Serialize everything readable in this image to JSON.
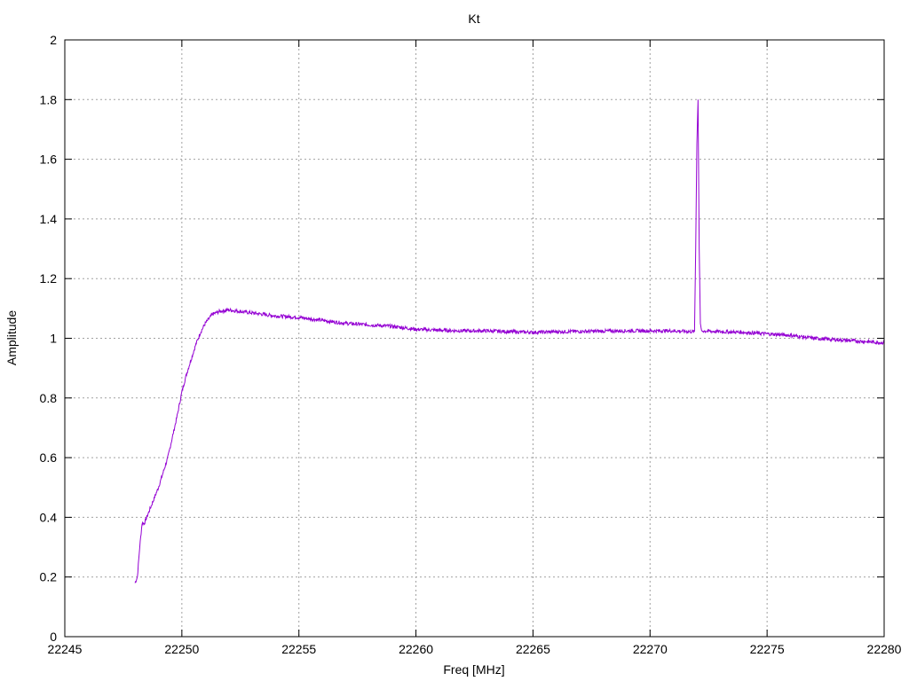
{
  "chart_data": {
    "type": "line",
    "title": "Kt",
    "xlabel": "Freq [MHz]",
    "ylabel": "Amplitude",
    "xlim": [
      22245,
      22280
    ],
    "ylim": [
      0,
      2
    ],
    "xticks": [
      "22245",
      "22250",
      "22255",
      "22260",
      "22265",
      "22270",
      "22275",
      "22280"
    ],
    "yticks": [
      "0",
      "0.2",
      "0.4",
      "0.6",
      "0.8",
      "1",
      "1.2",
      "1.4",
      "1.6",
      "1.8",
      "2"
    ],
    "grid": true,
    "series": [
      {
        "color": "#9400d3",
        "points": [
          [
            22248.0,
            0.18
          ],
          [
            22248.1,
            0.2
          ],
          [
            22248.2,
            0.3
          ],
          [
            22248.3,
            0.38
          ],
          [
            22248.4,
            0.38
          ],
          [
            22248.6,
            0.42
          ],
          [
            22248.8,
            0.46
          ],
          [
            22249.0,
            0.5
          ],
          [
            22249.2,
            0.55
          ],
          [
            22249.4,
            0.6
          ],
          [
            22249.6,
            0.67
          ],
          [
            22249.8,
            0.74
          ],
          [
            22250.0,
            0.82
          ],
          [
            22250.2,
            0.88
          ],
          [
            22250.4,
            0.93
          ],
          [
            22250.6,
            0.98
          ],
          [
            22250.8,
            1.02
          ],
          [
            22251.0,
            1.05
          ],
          [
            22251.3,
            1.08
          ],
          [
            22251.6,
            1.09
          ],
          [
            22252.0,
            1.095
          ],
          [
            22252.5,
            1.09
          ],
          [
            22253.0,
            1.085
          ],
          [
            22254.0,
            1.075
          ],
          [
            22255.0,
            1.07
          ],
          [
            22256.0,
            1.06
          ],
          [
            22257.0,
            1.05
          ],
          [
            22258.0,
            1.045
          ],
          [
            22259.0,
            1.04
          ],
          [
            22260.0,
            1.03
          ],
          [
            22261.0,
            1.027
          ],
          [
            22262.0,
            1.025
          ],
          [
            22263.0,
            1.025
          ],
          [
            22264.0,
            1.022
          ],
          [
            22265.0,
            1.02
          ],
          [
            22266.0,
            1.022
          ],
          [
            22267.0,
            1.023
          ],
          [
            22268.0,
            1.024
          ],
          [
            22269.0,
            1.025
          ],
          [
            22270.0,
            1.025
          ],
          [
            22271.0,
            1.025
          ],
          [
            22271.5,
            1.023
          ],
          [
            22271.9,
            1.022
          ],
          [
            22271.95,
            1.3
          ],
          [
            22272.0,
            1.65
          ],
          [
            22272.05,
            1.8
          ],
          [
            22272.1,
            1.3
          ],
          [
            22272.15,
            1.05
          ],
          [
            22272.2,
            1.025
          ],
          [
            22273.0,
            1.022
          ],
          [
            22274.0,
            1.02
          ],
          [
            22275.0,
            1.015
          ],
          [
            22276.0,
            1.01
          ],
          [
            22277.0,
            1.0
          ],
          [
            22278.0,
            0.995
          ],
          [
            22279.0,
            0.99
          ],
          [
            22280.0,
            0.985
          ]
        ]
      }
    ]
  }
}
